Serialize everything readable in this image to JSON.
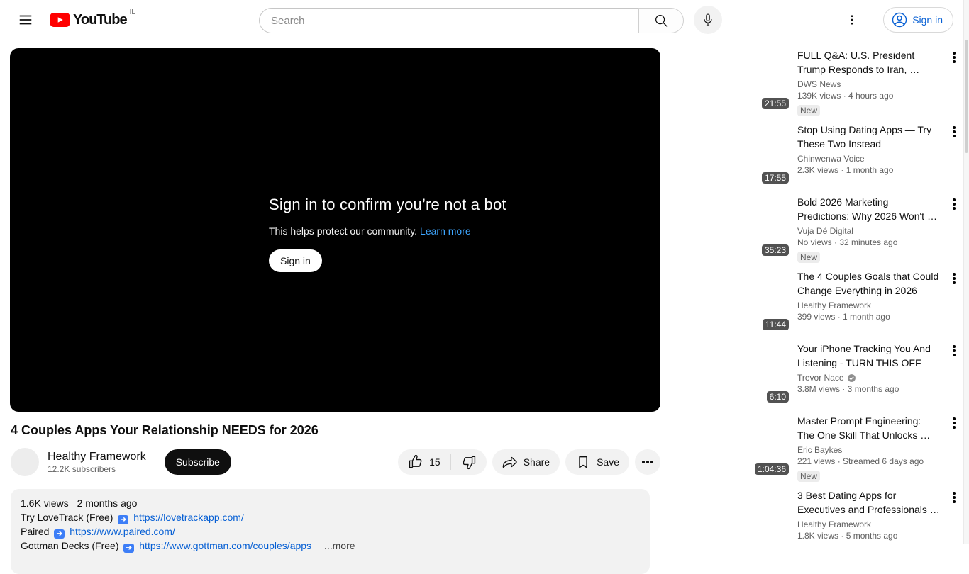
{
  "header": {
    "logo_text": "YouTube",
    "country_code": "IL",
    "search_placeholder": "Search",
    "sign_in_label": "Sign in"
  },
  "player": {
    "headline": "Sign in to confirm you’re not a bot",
    "subtext": "This helps protect our community.",
    "learn_more_label": "Learn more",
    "sign_in_label": "Sign in"
  },
  "video": {
    "title": "4 Couples Apps Your Relationship NEEDS for 2026",
    "channel": "Healthy Framework",
    "subscribers": "12.2K subscribers",
    "subscribe_label": "Subscribe",
    "like_count": "15",
    "share_label": "Share",
    "save_label": "Save"
  },
  "description": {
    "views": "1.6K views",
    "date": "2 months ago",
    "lines": [
      {
        "prefix": "Try LoveTrack (Free)",
        "link": "https://lovetrackapp.com/"
      },
      {
        "prefix": "Paired",
        "link": "https://www.paired.com/"
      },
      {
        "prefix": "Gottman Decks (Free)",
        "link": "https://www.gottman.com/couples/apps"
      }
    ],
    "more_label": "...more"
  },
  "sidebar": {
    "videos": [
      {
        "title": "FULL Q&A:  U.S. President Trump Responds to Iran, …",
        "channel": "DWS News",
        "meta": "139K views · 4 hours ago",
        "duration": "21:55",
        "badge": "New",
        "verified": false
      },
      {
        "title": "Stop Using Dating Apps — Try These Two Instead",
        "channel": "Chinwenwa Voice",
        "meta": "2.3K views · 1 month ago",
        "duration": "17:55",
        "badge": "",
        "verified": false
      },
      {
        "title": "Bold 2026 Marketing Predictions: Why 2026 Won't …",
        "channel": "Vuja Dé Digital",
        "meta": "No views · 32 minutes ago",
        "duration": "35:23",
        "badge": "New",
        "verified": false
      },
      {
        "title": "The 4 Couples Goals that Could Change Everything in 2026",
        "channel": "Healthy Framework",
        "meta": "399 views · 1 month ago",
        "duration": "11:44",
        "badge": "",
        "verified": false
      },
      {
        "title": "Your iPhone Tracking You And Listening - TURN THIS OFF",
        "channel": "Trevor Nace",
        "meta": "3.8M views · 3 months ago",
        "duration": "6:10",
        "badge": "",
        "verified": true
      },
      {
        "title": "Master Prompt Engineering: The One Skill That Unlocks …",
        "channel": "Eric Baykes",
        "meta": "221 views · Streamed 6 days ago",
        "duration": "1:04:36",
        "badge": "New",
        "verified": false
      },
      {
        "title": "3 Best Dating Apps for Executives and Professionals …",
        "channel": "Healthy Framework",
        "meta": "1.8K views · 5 months ago",
        "duration": "",
        "badge": "",
        "verified": false
      }
    ]
  },
  "colors": {
    "brand_red": "#ff0000",
    "link_blue": "#065fd4",
    "player_link_blue": "#3ea6ff",
    "text_primary": "#0f0f0f",
    "text_secondary": "#606060"
  }
}
